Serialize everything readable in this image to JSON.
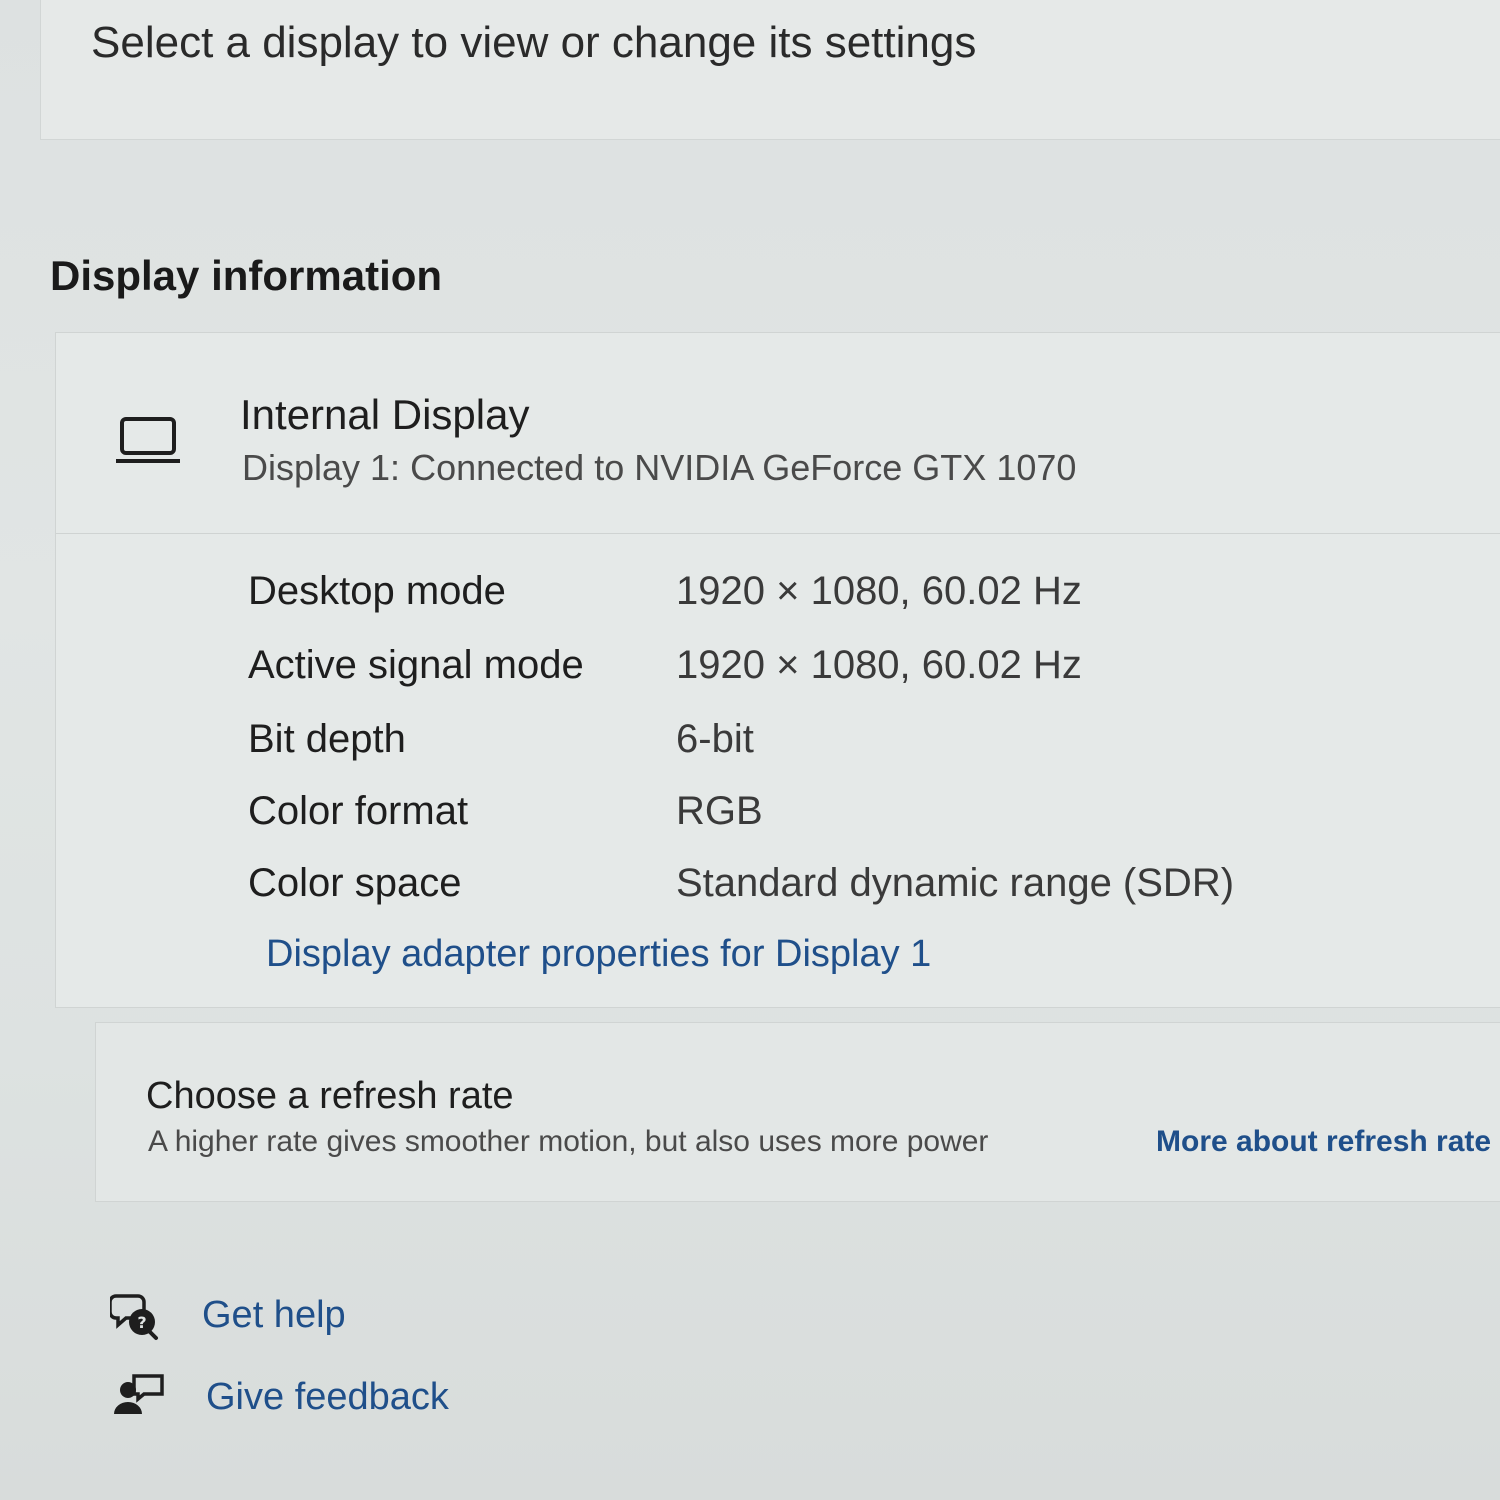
{
  "header": {
    "hint": "Select a display to view or change its settings"
  },
  "display_information": {
    "title": "Display information",
    "display_name": "Internal Display",
    "display_sub": "Display 1: Connected to NVIDIA GeForce GTX 1070",
    "properties": [
      {
        "label": "Desktop mode",
        "value": "1920 × 1080, 60.02 Hz"
      },
      {
        "label": "Active signal mode",
        "value": "1920 × 1080, 60.02 Hz"
      },
      {
        "label": "Bit depth",
        "value": "6-bit"
      },
      {
        "label": "Color format",
        "value": "RGB"
      },
      {
        "label": "Color space",
        "value": "Standard dynamic range (SDR)"
      }
    ],
    "adapter_link": "Display adapter properties for Display 1"
  },
  "refresh_rate": {
    "title": "Choose a refresh rate",
    "description": "A higher rate gives smoother motion, but also uses more power",
    "link": "More about refresh rate"
  },
  "footer": {
    "get_help": "Get help",
    "give_feedback": "Give feedback"
  },
  "colors": {
    "accent_link": "#1f4f8a",
    "background": "#dfe3e3"
  },
  "icons": {
    "display": "laptop-monitor-icon",
    "help": "help-chat-icon",
    "feedback": "feedback-person-icon"
  }
}
